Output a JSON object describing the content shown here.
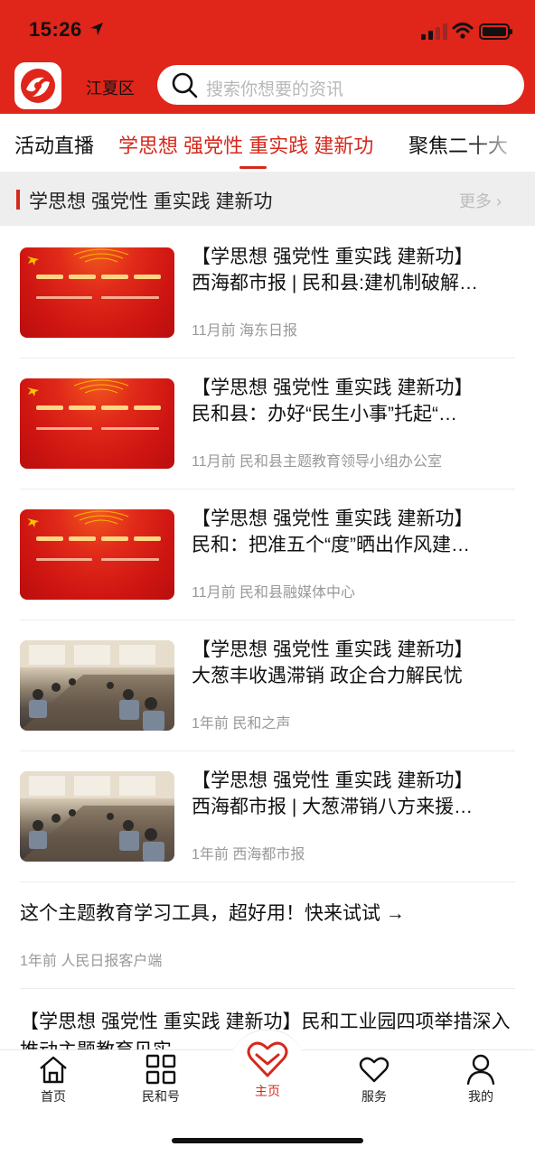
{
  "status": {
    "time": "15:26"
  },
  "header": {
    "district": "江夏区",
    "search_placeholder": "搜索你想要的资讯",
    "accent": "#e0251b"
  },
  "tabs": [
    {
      "label": "活动直播",
      "active": false
    },
    {
      "label": "学思想 强党性 重实践 建新功",
      "active": true
    },
    {
      "label": "聚焦二十大",
      "active": false
    }
  ],
  "section": {
    "title": "学思想 强党性 重实践 建新功",
    "more": "更多 ›"
  },
  "news": [
    {
      "line1": "【学思想 强党性 重实践 建新功】",
      "line2": "西海都市报 | 民和县:建机制破解…",
      "meta": "11月前 海东日报",
      "thumb": "red-banner"
    },
    {
      "line1": "【学思想 强党性 重实践 建新功】",
      "line2": "民和县：办好“民生小事”托起“…",
      "meta": "11月前 民和县主题教育领导小组办公室",
      "thumb": "red-banner"
    },
    {
      "line1": "【学思想 强党性 重实践 建新功】",
      "line2": "民和：把准五个“度”晒出作风建…",
      "meta": "11月前 民和县融媒体中心",
      "thumb": "red-banner"
    },
    {
      "line1": "【学思想 强党性 重实践 建新功】",
      "line2": "大葱丰收遇滞销 政企合力解民忧",
      "meta": "1年前 民和之声",
      "thumb": "meeting-photo"
    },
    {
      "line1": "【学思想 强党性 重实践 建新功】",
      "line2": "西海都市报 | 大葱滞销八方来援…",
      "meta": "1年前 西海都市报",
      "thumb": "meeting-photo"
    }
  ],
  "plain_items": [
    {
      "title": "这个主题教育学习工具，超好用！快来试试 →",
      "meta": "1年前 人民日报客户端"
    },
    {
      "title": "【学思想 强党性 重实践 建新功】民和工业园四项举措深入推动主题教育见实",
      "meta": ""
    }
  ],
  "bottom_nav": [
    {
      "label": "首页",
      "icon": "home-icon",
      "active": false
    },
    {
      "label": "民和号",
      "icon": "grid-icon",
      "active": false
    },
    {
      "label": "主页",
      "icon": "heart-icon",
      "active": true
    },
    {
      "label": "服务",
      "icon": "heart-outline-icon",
      "active": false
    },
    {
      "label": "我的",
      "icon": "user-icon",
      "active": false
    }
  ]
}
